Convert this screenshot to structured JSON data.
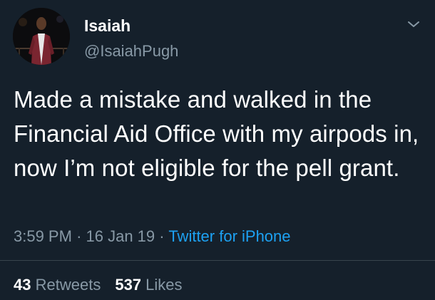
{
  "tweet": {
    "display_name": "Isaiah",
    "handle": "@IsaiahPugh",
    "text": "Made a mistake and walked in the Financial Aid Office with my airpods in, now I’m not eligible for the pell grant.",
    "time": "3:59 PM",
    "date": "16 Jan 19",
    "separator": "·",
    "source": "Twitter for iPhone"
  },
  "stats": {
    "retweets_count": "43",
    "retweets_label": "Retweets",
    "likes_count": "537",
    "likes_label": "Likes"
  },
  "icons": {
    "more": "chevron-down-icon"
  },
  "colors": {
    "background": "#15202b",
    "primary_text": "#ffffff",
    "secondary_text": "#8899a6",
    "link": "#1da1f2",
    "divider": "#38444d"
  }
}
